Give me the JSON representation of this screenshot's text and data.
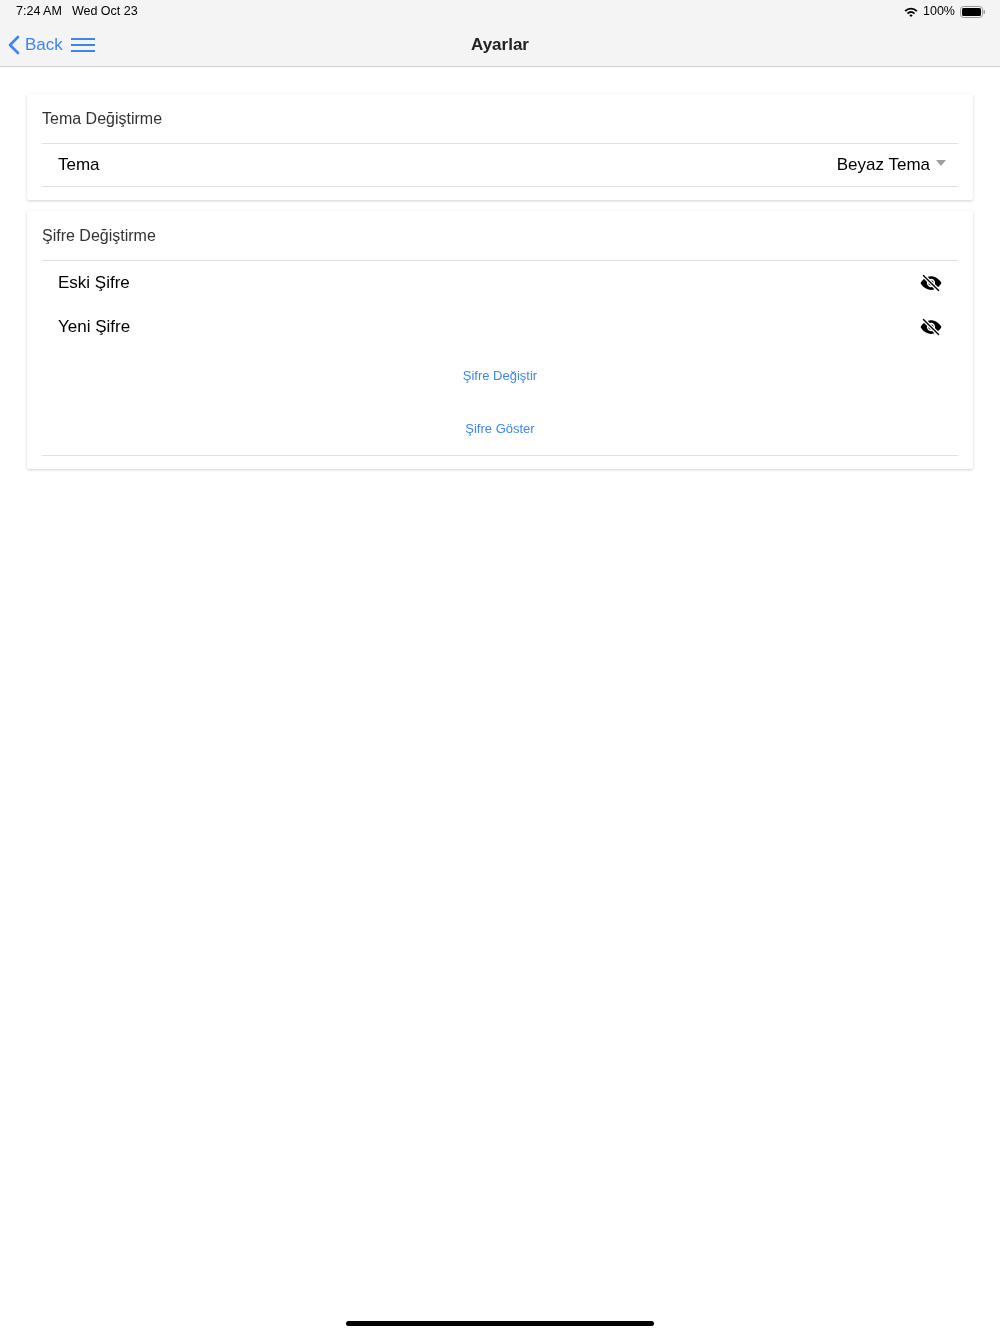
{
  "status_bar": {
    "time": "7:24 AM",
    "date": "Wed Oct 23",
    "battery": "100%"
  },
  "nav_bar": {
    "back": "Back",
    "title": "Ayarlar"
  },
  "sections": [
    {
      "title": "Tema Değiştirme",
      "rows": [
        {
          "kind": "select",
          "label": "Tema",
          "value": "Beyaz Tema"
        }
      ]
    },
    {
      "title": "Şifre Değiştirme",
      "rows": [
        {
          "kind": "password",
          "placeholder": "Eski Şifre"
        },
        {
          "kind": "password",
          "placeholder": "Yeni Şifre"
        },
        {
          "kind": "link",
          "label": "Şifre Değiştir"
        },
        {
          "kind": "link",
          "label": "Şifre Göster"
        }
      ]
    }
  ]
}
